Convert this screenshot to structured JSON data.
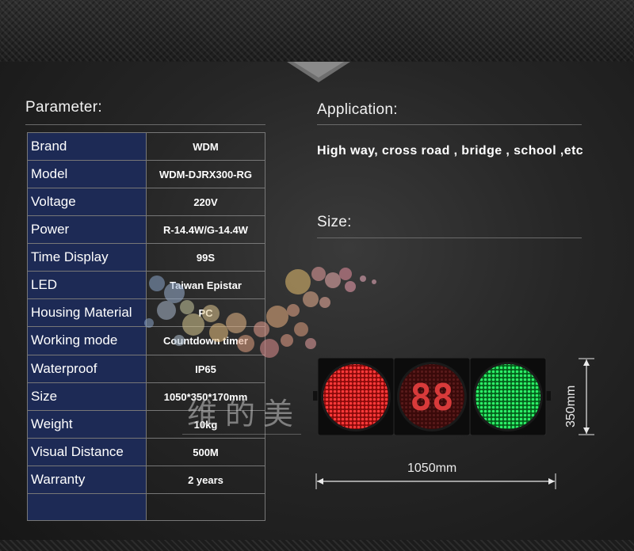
{
  "parameter": {
    "title": "Parameter:",
    "rows": [
      {
        "label": "Brand",
        "value": "WDM"
      },
      {
        "label": "Model",
        "value": "WDM-DJRX300-RG"
      },
      {
        "label": "Voltage",
        "value": "220V"
      },
      {
        "label": "Power",
        "value": "R-14.4W/G-14.4W"
      },
      {
        "label": "Time Display",
        "value": "99S"
      },
      {
        "label": "LED",
        "value": "Taiwan Epistar"
      },
      {
        "label": "Housing Material",
        "value": "PC"
      },
      {
        "label": "Working mode",
        "value": "Countdown timer"
      },
      {
        "label": "Waterproof",
        "value": "IP65"
      },
      {
        "label": "Size",
        "value": "1050*350*170mm"
      },
      {
        "label": "Weight",
        "value": "10kg"
      },
      {
        "label": "Visual Distance",
        "value": "500M"
      },
      {
        "label": "Warranty",
        "value": "2  years"
      }
    ]
  },
  "application": {
    "title": "Application:",
    "text": "High way, cross road , bridge , school ,etc"
  },
  "size": {
    "title": "Size:",
    "width_label": "1050mm",
    "height_label": "350mm"
  },
  "watermark": {
    "text": "维的美"
  },
  "colors": {
    "table_key_bg": "#1d2a55",
    "red_light": "#e02020",
    "green_light": "#10c040",
    "countdown": "#c01818"
  },
  "signal": {
    "countdown_digits": "88"
  }
}
